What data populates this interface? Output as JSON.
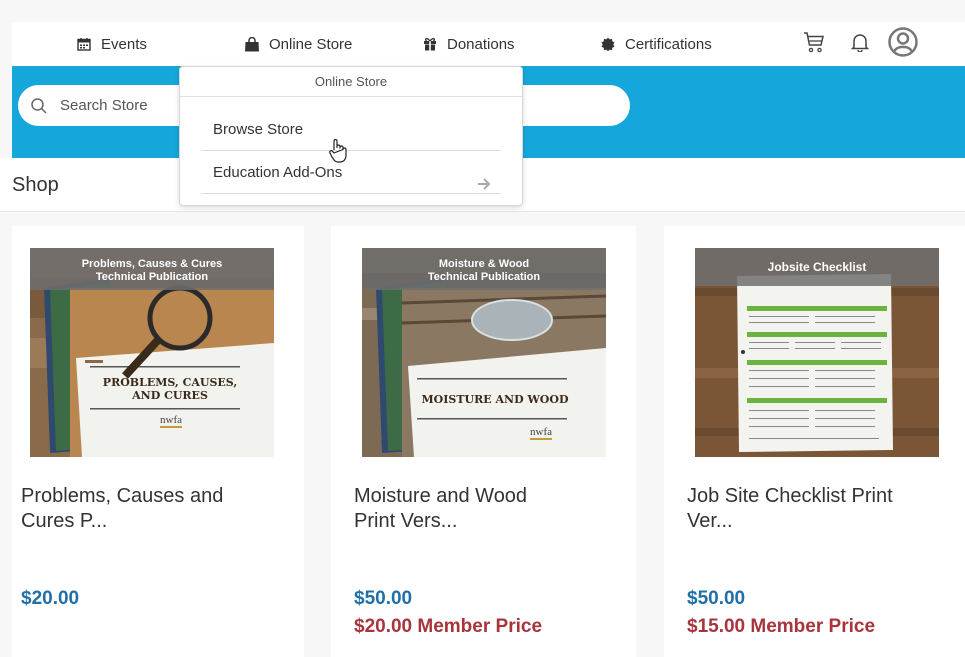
{
  "nav": {
    "events_label": "Events",
    "store_label": "Online Store",
    "donations_label": "Donations",
    "certifications_label": "Certifications",
    "icons": {
      "events": "calendar-icon",
      "store": "shopping-bag-icon",
      "donations": "gift-icon",
      "certifications": "badge-icon",
      "cart": "cart-icon",
      "notifications": "bell-icon",
      "account": "user-avatar-icon"
    }
  },
  "search": {
    "placeholder": "Search Store"
  },
  "dropdown": {
    "header": "Online Store",
    "items": [
      {
        "label": "Browse Store"
      },
      {
        "label": "Education Add-Ons"
      }
    ]
  },
  "shop": {
    "title": "Shop"
  },
  "products": [
    {
      "banner_line1": "Problems, Causes & Cures",
      "banner_line2": "Technical Publication",
      "cover_text": "PROBLEMS, CAUSES, AND CURES",
      "logo_text": "nwfa",
      "title_line1": "Problems, Causes and",
      "title_line2": "Cures P...",
      "price": "$20.00"
    },
    {
      "banner_line1": "Moisture & Wood",
      "banner_line2": "Technical Publication",
      "cover_text": "MOISTURE AND WOOD",
      "logo_text": "nwfa",
      "title_line1": "Moisture and Wood",
      "title_line2": "Print Vers...",
      "price": "$50.00",
      "member_price": "$20.00 Member Price"
    },
    {
      "banner_line1": "Jobsite Checklist",
      "title_line1": "Job Site Checklist Print",
      "title_line2": "Ver...",
      "price": "$50.00",
      "member_price": "$15.00 Member Price"
    }
  ],
  "colors": {
    "band": "#15a6dc",
    "price": "#1f6fa8",
    "member_price": "#a8343c"
  }
}
